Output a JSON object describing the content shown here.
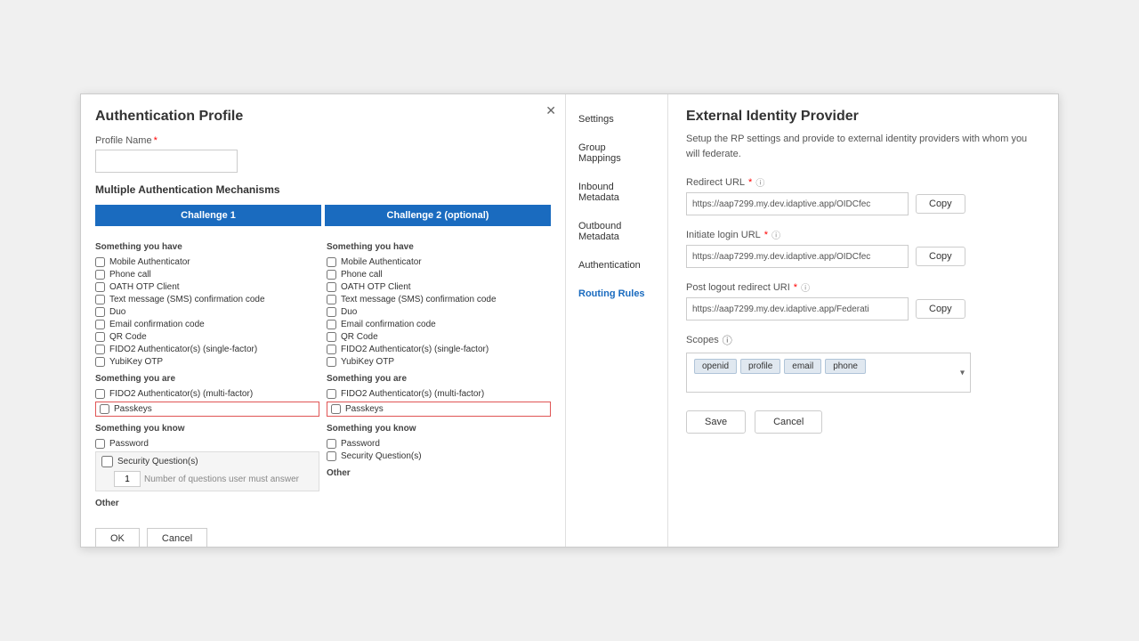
{
  "leftPanel": {
    "title": "Authentication Profile",
    "profileName": {
      "label": "Profile Name",
      "required": true,
      "value": ""
    },
    "sectionTitle": "Multiple Authentication Mechanisms",
    "challenge1": {
      "label": "Challenge 1"
    },
    "challenge2": {
      "label": "Challenge 2 (optional)"
    },
    "col1": {
      "somethingYouHave": "Something you have",
      "items": [
        "Mobile Authenticator",
        "Phone call",
        "OATH OTP Client",
        "Text message (SMS) confirmation code",
        "Duo",
        "Email confirmation code",
        "QR Code",
        "FIDO2 Authenticator(s) (single-factor)",
        "YubiKey OTP"
      ],
      "somethingYouAre": "Something you are",
      "areItems": [
        "FIDO2 Authenticator(s) (multi-factor)"
      ],
      "passkeys": "Passkeys",
      "somethingYouKnow": "Something you know",
      "knowItems": [
        "Password"
      ],
      "securityQuestions": "Security Question(s)",
      "numQuestionsLabel": "Number of questions user must answer",
      "numQuestionsValue": "1",
      "other": "Other"
    },
    "col2": {
      "somethingYouHave": "Something you have",
      "items": [
        "Mobile Authenticator",
        "Phone call",
        "OATH OTP Client",
        "Text message (SMS) confirmation code",
        "Duo",
        "Email confirmation code",
        "QR Code",
        "FIDO2 Authenticator(s) (single-factor)",
        "YubiKey OTP"
      ],
      "somethingYouAre": "Something you are",
      "areItems": [
        "FIDO2 Authenticator(s) (multi-factor)"
      ],
      "passkeys": "Passkeys",
      "somethingYouKnow": "Something you know",
      "knowItems": [
        "Password"
      ],
      "securityQuestions": "Security Question(s)",
      "other": "Other"
    },
    "okLabel": "OK",
    "cancelLabel": "Cancel"
  },
  "nav": {
    "items": [
      "Settings",
      "Group Mappings",
      "Inbound Metadata",
      "Outbound Metadata",
      "Authentication",
      "Routing Rules"
    ],
    "activeIndex": 5
  },
  "rightPanel": {
    "title": "External Identity Provider",
    "description": "Setup the RP settings and provide to external identity providers with whom you will federate.",
    "redirectURL": {
      "label": "Redirect URL",
      "required": true,
      "value": "https://aap7299.my.dev.idaptive.app/OIDCfec",
      "copyLabel": "Copy"
    },
    "initiateLoginURL": {
      "label": "Initiate login URL",
      "required": true,
      "value": "https://aap7299.my.dev.idaptive.app/OIDCfec",
      "copyLabel": "Copy"
    },
    "postLogoutURI": {
      "label": "Post logout redirect URI",
      "required": true,
      "value": "https://aap7299.my.dev.idaptive.app/Federati",
      "copyLabel": "Copy"
    },
    "scopes": {
      "label": "Scopes",
      "tags": [
        "openid",
        "profile",
        "email",
        "phone"
      ]
    },
    "saveLabel": "Save",
    "cancelLabel": "Cancel"
  }
}
